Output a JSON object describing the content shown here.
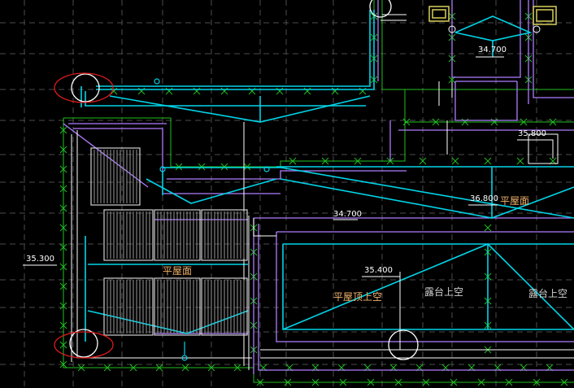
{
  "drawing": {
    "background": "#000000",
    "colors": {
      "wall_cyan": "#00d4e8",
      "line_purple": "#b07cff",
      "green_dim": "#1fbf1f",
      "grid_gray": "#4a4a4a",
      "white": "#ffffff",
      "red_marker": "#e01c1c",
      "yellow_box": "#d8cf5a",
      "window_gray": "#cfcfcf"
    },
    "labels": {
      "elev_34700_top": "34.700",
      "elev_35800": "35.800",
      "elev_36800": "36.800",
      "roof_label_right": "平屋面",
      "elev_34700_mid": "34.700",
      "elev_35300": "35.300",
      "roof_label_left": "平屋面",
      "elev_35400": "35.400",
      "roof_top_empty": "平屋顶上空",
      "terrace_empty_1": "露台上空",
      "terrace_empty_2": "露台上空"
    },
    "icons": [
      "grid-bubble",
      "revision-cloud",
      "drain-marker",
      "window-hatch",
      "tank-box"
    ]
  }
}
